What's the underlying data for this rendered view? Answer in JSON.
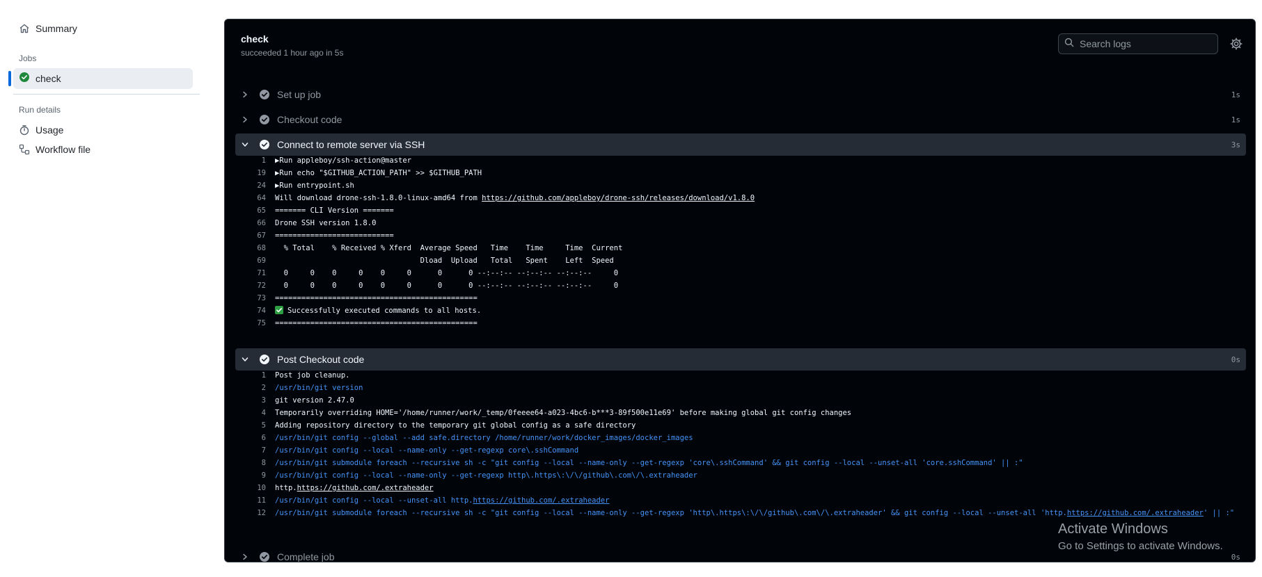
{
  "sidebar": {
    "summary_label": "Summary",
    "jobs_heading": "Jobs",
    "job_label": "check",
    "run_details_heading": "Run details",
    "usage_label": "Usage",
    "workflow_file_label": "Workflow file"
  },
  "job": {
    "title": "check",
    "subtitle": "succeeded 1 hour ago in 5s"
  },
  "search": {
    "placeholder": "Search logs"
  },
  "steps": [
    {
      "name": "Set up job",
      "duration": "1s",
      "expanded": false
    },
    {
      "name": "Checkout code",
      "duration": "1s",
      "expanded": false
    },
    {
      "name": "Connect to remote server via SSH",
      "duration": "3s",
      "expanded": true
    },
    {
      "name": "Post Checkout code",
      "duration": "0s",
      "expanded": true
    },
    {
      "name": "Complete job",
      "duration": "0s",
      "expanded": false
    }
  ],
  "ssh_log": [
    {
      "n": "1",
      "text": "Run appleboy/ssh-action@master"
    },
    {
      "n": "19",
      "text": "Run echo \"$GITHUB_ACTION_PATH\" >> $GITHUB_PATH"
    },
    {
      "n": "24",
      "text": "Run entrypoint.sh"
    },
    {
      "n": "64",
      "text": "Will download drone-ssh-1.8.0-linux-amd64 from ",
      "link": "https://github.com/appleboy/drone-ssh/releases/download/v1.8.0"
    },
    {
      "n": "65",
      "text": "======= CLI Version ======="
    },
    {
      "n": "66",
      "text": "Drone SSH version 1.8.0"
    },
    {
      "n": "67",
      "text": "==========================="
    },
    {
      "n": "68",
      "text": "  % Total    % Received % Xferd  Average Speed   Time    Time     Time  Current"
    },
    {
      "n": "69",
      "text": "                                 Dload  Upload   Total   Spent    Left  Speed"
    },
    {
      "n": "71",
      "text": "  0     0    0     0    0     0      0      0 --:--:-- --:--:-- --:--:--     0"
    },
    {
      "n": "72",
      "text": "  0     0    0     0    0     0      0      0 --:--:-- --:--:-- --:--:--     0"
    },
    {
      "n": "73",
      "text": "=============================================="
    },
    {
      "n": "74",
      "text": "Successfully executed commands to all hosts."
    },
    {
      "n": "75",
      "text": "=============================================="
    }
  ],
  "post_log": [
    {
      "n": "1",
      "text": "Post job cleanup."
    },
    {
      "n": "2",
      "text": "/usr/bin/git version"
    },
    {
      "n": "3",
      "text": "git version 2.47.0"
    },
    {
      "n": "4",
      "text": "Temporarily overriding HOME='/home/runner/work/_temp/0feeee64-a023-4bc6-b***3-89f500e11e69' before making global git config changes"
    },
    {
      "n": "5",
      "text": "Adding repository directory to the temporary git global config as a safe directory"
    },
    {
      "n": "6",
      "text": "/usr/bin/git config --global --add safe.directory /home/runner/work/docker_images/docker_images"
    },
    {
      "n": "7",
      "text": "/usr/bin/git config --local --name-only --get-regexp core\\.sshCommand"
    },
    {
      "n": "8",
      "text": "/usr/bin/git submodule foreach --recursive sh -c \"git config --local --name-only --get-regexp 'core\\.sshCommand' && git config --local --unset-all 'core.sshCommand' || :\""
    },
    {
      "n": "9",
      "text": "/usr/bin/git config --local --name-only --get-regexp http\\.https\\:\\/\\/github\\.com\\/\\.extraheader"
    },
    {
      "n": "10",
      "pre": "http.",
      "link": "https://github.com/.extraheader"
    },
    {
      "n": "11",
      "pre": "/usr/bin/git config --local --unset-all http.",
      "link": "https://github.com/.extraheader"
    },
    {
      "n": "12",
      "pre": "/usr/bin/git submodule foreach --recursive sh -c \"git config --local --name-only --get-regexp 'http\\.https\\:\\/\\/github\\.com\\/\\.extraheader' && git config --local --unset-all 'http.",
      "link": "https://github.com/.extraheader",
      "post": "' || :\""
    }
  ],
  "watermark": {
    "line1": "Activate Windows",
    "line2": "Go to Settings to activate Windows."
  },
  "colors": {
    "accent": "#0969da",
    "success": "#1f883d",
    "log_command": "#4493f8",
    "panel_bg": "#010409"
  }
}
